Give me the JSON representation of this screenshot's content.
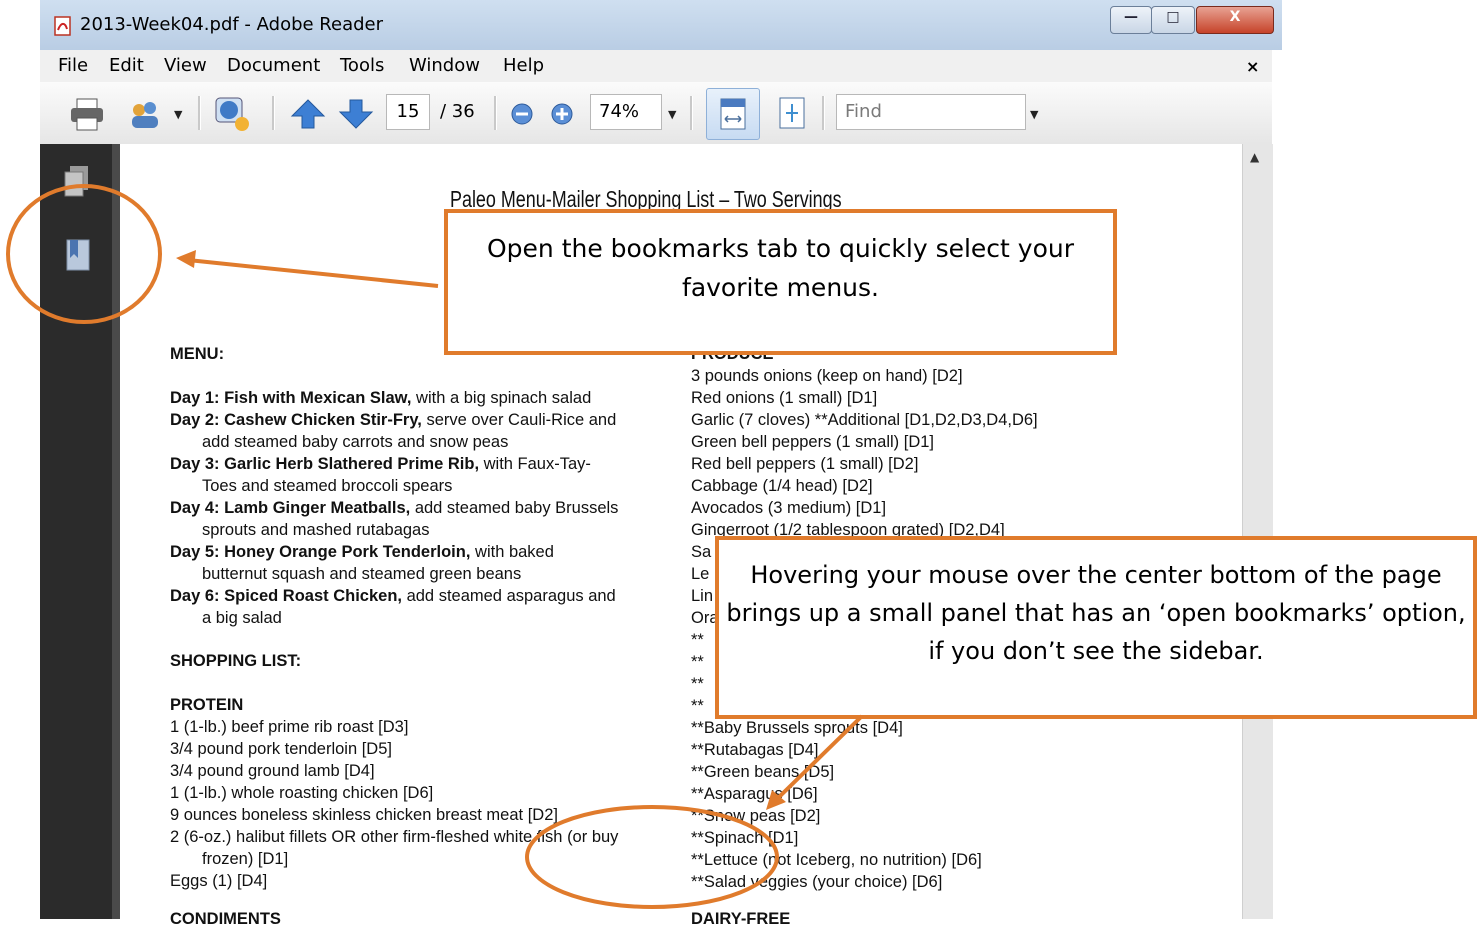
{
  "window": {
    "title": "2013-Week04.pdf - Adobe Reader"
  },
  "menus": [
    "File",
    "Edit",
    "View",
    "Document",
    "Tools",
    "Window",
    "Help"
  ],
  "menubar_close": "×",
  "toolbar": {
    "page": "15",
    "page_total": "/ 36",
    "zoom": "74%",
    "find_placeholder": "Find"
  },
  "document": {
    "title": "Paleo Menu-Mailer Shopping List – Two Servings",
    "menu_heading": "MENU:",
    "menu_days": [
      {
        "day": "Day 1: Fish with Mexican Slaw,",
        "rest": " with a big spinach salad",
        "cont": ""
      },
      {
        "day": "Day 2: Cashew Chicken Stir-Fry,",
        "rest": " serve over Cauli-Rice and",
        "cont": "add steamed baby carrots and snow peas"
      },
      {
        "day": "Day 3: Garlic Herb Slathered Prime Rib,",
        "rest": " with Faux-Tay-",
        "cont": "Toes and steamed broccoli spears"
      },
      {
        "day": "Day 4: Lamb Ginger Meatballs,",
        "rest": " add steamed baby Brussels",
        "cont": "sprouts and mashed rutabagas"
      },
      {
        "day": "Day 5: Honey Orange Pork Tenderloin,",
        "rest": " with baked",
        "cont": "butternut squash and steamed green beans"
      },
      {
        "day": "Day 6: Spiced Roast Chicken,",
        "rest": " add steamed asparagus and",
        "cont": "a big salad"
      }
    ],
    "shopping_heading": "SHOPPING LIST:",
    "protein_heading": "PROTEIN",
    "protein": [
      "1 (1-lb.) beef prime rib roast [D3]",
      "3/4 pound pork tenderloin [D5]",
      "3/4 pound ground lamb [D4]",
      "1 (1-lb.) whole roasting chicken [D6]",
      "9 ounces boneless skinless chicken breast meat [D2]",
      "2 (6-oz.) halibut fillets OR other firm-fleshed white fish (or buy",
      "frozen) [D1]",
      "Eggs (1) [D4]"
    ],
    "condiments_heading": "CONDIMENTS",
    "produce_heading": "PRODUCE",
    "produce": [
      "3 pounds onions (keep on hand) [D2]",
      "Red onions (1 small) [D1]",
      "Garlic (7 cloves) **Additional [D1,D2,D3,D4,D6]",
      "Green bell peppers (1 small) [D1]",
      "Red bell peppers (1 small) [D2]",
      "Cabbage (1/4 head) [D2]",
      "Avocados (3 medium) [D1]",
      "Gingerroot (1/2 tablespoon grated) [D2,D4]",
      "Sa",
      "Le",
      "Lin",
      "Ora",
      "**",
      "**",
      "**",
      "**",
      "**Baby Brussels sprouts [D4]",
      "**Rutabagas [D4]",
      "**Green beans [D5]",
      "**Asparagus [D6]",
      "**Snow peas [D2]",
      "**Spinach [D1]",
      "**Lettuce (not Iceberg, no nutrition) [D6]",
      "**Salad veggies (your choice) [D6]"
    ],
    "dairy_heading": "DAIRY-FREE"
  },
  "annotations": {
    "callout_1": "Open the bookmarks tab to quickly select your favorite menus.",
    "callout_2": "Hovering your mouse over the center bottom of the page brings up a small panel that has an ‘open bookmarks’ option, if you don’t see the sidebar."
  },
  "colors": {
    "annotation": "#e07b2c",
    "navpane": "#2b2b2b"
  }
}
